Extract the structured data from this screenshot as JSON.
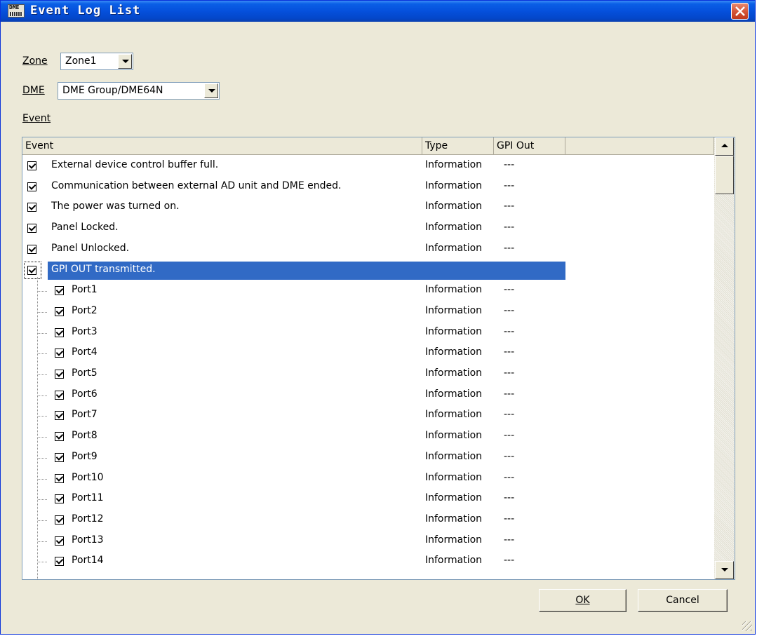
{
  "window": {
    "title": "Event Log List",
    "app_icon_label": "DME"
  },
  "zone": {
    "label": "Zone",
    "value": "Zone1"
  },
  "dme": {
    "label": "DME",
    "value": "DME Group/DME64N"
  },
  "event_section_label": "Event",
  "columns": [
    "Event",
    "Type",
    "GPI Out"
  ],
  "rows": [
    {
      "event": "External device control buffer full.",
      "type": "Information",
      "gpi_out": "---",
      "level": 0,
      "checked": true
    },
    {
      "event": "Communication between external AD unit and DME ended.",
      "type": "Information",
      "gpi_out": "---",
      "level": 0,
      "checked": true
    },
    {
      "event": "The power was turned on.",
      "type": "Information",
      "gpi_out": "---",
      "level": 0,
      "checked": true
    },
    {
      "event": "Panel Locked.",
      "type": "Information",
      "gpi_out": "---",
      "level": 0,
      "checked": true
    },
    {
      "event": "Panel Unlocked.",
      "type": "Information",
      "gpi_out": "---",
      "level": 0,
      "checked": true
    },
    {
      "event": "GPI OUT transmitted.",
      "type": "",
      "gpi_out": "",
      "level": 0,
      "checked": true,
      "selected": true
    },
    {
      "event": "Port1",
      "type": "Information",
      "gpi_out": "---",
      "level": 1,
      "checked": true
    },
    {
      "event": "Port2",
      "type": "Information",
      "gpi_out": "---",
      "level": 1,
      "checked": true
    },
    {
      "event": "Port3",
      "type": "Information",
      "gpi_out": "---",
      "level": 1,
      "checked": true
    },
    {
      "event": "Port4",
      "type": "Information",
      "gpi_out": "---",
      "level": 1,
      "checked": true
    },
    {
      "event": "Port5",
      "type": "Information",
      "gpi_out": "---",
      "level": 1,
      "checked": true
    },
    {
      "event": "Port6",
      "type": "Information",
      "gpi_out": "---",
      "level": 1,
      "checked": true
    },
    {
      "event": "Port7",
      "type": "Information",
      "gpi_out": "---",
      "level": 1,
      "checked": true
    },
    {
      "event": "Port8",
      "type": "Information",
      "gpi_out": "---",
      "level": 1,
      "checked": true
    },
    {
      "event": "Port9",
      "type": "Information",
      "gpi_out": "---",
      "level": 1,
      "checked": true
    },
    {
      "event": "Port10",
      "type": "Information",
      "gpi_out": "---",
      "level": 1,
      "checked": true
    },
    {
      "event": "Port11",
      "type": "Information",
      "gpi_out": "---",
      "level": 1,
      "checked": true
    },
    {
      "event": "Port12",
      "type": "Information",
      "gpi_out": "---",
      "level": 1,
      "checked": true
    },
    {
      "event": "Port13",
      "type": "Information",
      "gpi_out": "---",
      "level": 1,
      "checked": true
    },
    {
      "event": "Port14",
      "type": "Information",
      "gpi_out": "---",
      "level": 1,
      "checked": true
    }
  ],
  "buttons": {
    "ok": "OK",
    "cancel": "Cancel"
  },
  "colors": {
    "titlebar": "#0550dc",
    "selection": "#316ac5",
    "dialog_bg": "#ece9d8"
  }
}
